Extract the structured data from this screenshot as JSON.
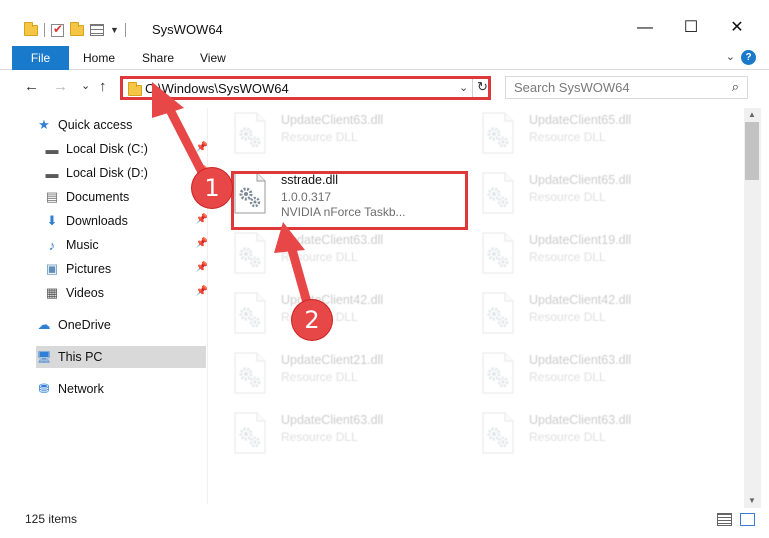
{
  "window": {
    "title": "SysWOW64",
    "minimize_glyph": "—",
    "maximize_glyph": "☐",
    "close_glyph": "✕"
  },
  "ribbon": {
    "tabs": [
      "File",
      "Home",
      "Share",
      "View"
    ],
    "expand_glyph": "⌄",
    "help_glyph": "?"
  },
  "navigation": {
    "back_glyph": "←",
    "forward_glyph": "→",
    "recent_glyph": "⌄",
    "up_glyph": "↑",
    "address": "C:\\Windows\\SysWOW64",
    "address_dropdown_glyph": "⌄",
    "refresh_glyph": "↻",
    "search_placeholder": "Search SysWOW64",
    "search_glyph": "⌕"
  },
  "sidebar": {
    "items": [
      {
        "label": "Quick access",
        "icon": "star-icon",
        "glyph": "★",
        "color": "#2f7fd6",
        "pinned": false
      },
      {
        "label": "Local Disk (C:)",
        "icon": "drive-icon",
        "glyph": "▬",
        "color": "#5a5a5a",
        "pinned": true
      },
      {
        "label": "Local Disk (D:)",
        "icon": "drive-icon",
        "glyph": "▬",
        "color": "#5a5a5a",
        "pinned": true
      },
      {
        "label": "Documents",
        "icon": "documents-icon",
        "glyph": "▤",
        "color": "#6f6f6f",
        "pinned": true
      },
      {
        "label": "Downloads",
        "icon": "download-icon",
        "glyph": "⬇",
        "color": "#2f7fd6",
        "pinned": true
      },
      {
        "label": "Music",
        "icon": "music-icon",
        "glyph": "♪",
        "color": "#2f7fd6",
        "pinned": true
      },
      {
        "label": "Pictures",
        "icon": "pictures-icon",
        "glyph": "▣",
        "color": "#5e8fb8",
        "pinned": true
      },
      {
        "label": "Videos",
        "icon": "videos-icon",
        "glyph": "▦",
        "color": "#555555",
        "pinned": true
      },
      {
        "label": "OneDrive",
        "icon": "cloud-icon",
        "glyph": "☁",
        "color": "#2f7fd6",
        "pinned": false
      },
      {
        "label": "This PC",
        "icon": "computer-icon",
        "glyph": "🖥",
        "color": "#2f7fd6",
        "pinned": false,
        "selected": true
      },
      {
        "label": "Network",
        "icon": "network-icon",
        "glyph": "⛃",
        "color": "#2f7fd6",
        "pinned": false
      }
    ],
    "pin_glyph": "📌"
  },
  "files": {
    "left_column": [
      {
        "name": "UpdateClient63.dll",
        "type": "Resource DLL",
        "faded": true
      },
      {
        "name": "sstrade.dll",
        "type": "1.0.0.317",
        "desc": "NVIDIA nForce Taskb...",
        "faded": false
      },
      {
        "name": "UpdateClient63.dll",
        "type": "Resource DLL",
        "faded": true
      },
      {
        "name": "UpdateClient42.dll",
        "type": "Resource DLL",
        "faded": true
      },
      {
        "name": "UpdateClient21.dll",
        "type": "Resource DLL",
        "faded": true
      },
      {
        "name": "UpdateClient63.dll",
        "type": "Resource DLL",
        "faded": true
      }
    ],
    "right_column": [
      {
        "name": "UpdateClient65.dll",
        "type": "Resource DLL",
        "faded": true
      },
      {
        "name": "UpdateClient65.dll",
        "type": "Resource DLL",
        "faded": true
      },
      {
        "name": "UpdateClient19.dll",
        "type": "Resource DLL",
        "faded": true
      },
      {
        "name": "UpdateClient42.dll",
        "type": "Resource DLL",
        "faded": true
      },
      {
        "name": "UpdateClient63.dll",
        "type": "Resource DLL",
        "faded": true
      },
      {
        "name": "UpdateClient63.dll",
        "type": "Resource DLL",
        "faded": true
      }
    ]
  },
  "scrollbar": {
    "up_glyph": "▲",
    "down_glyph": "▼"
  },
  "status": {
    "item_count": "125 items"
  },
  "annotations": {
    "callout_1": "1",
    "callout_2": "2",
    "accent_color": "#e0383a"
  }
}
